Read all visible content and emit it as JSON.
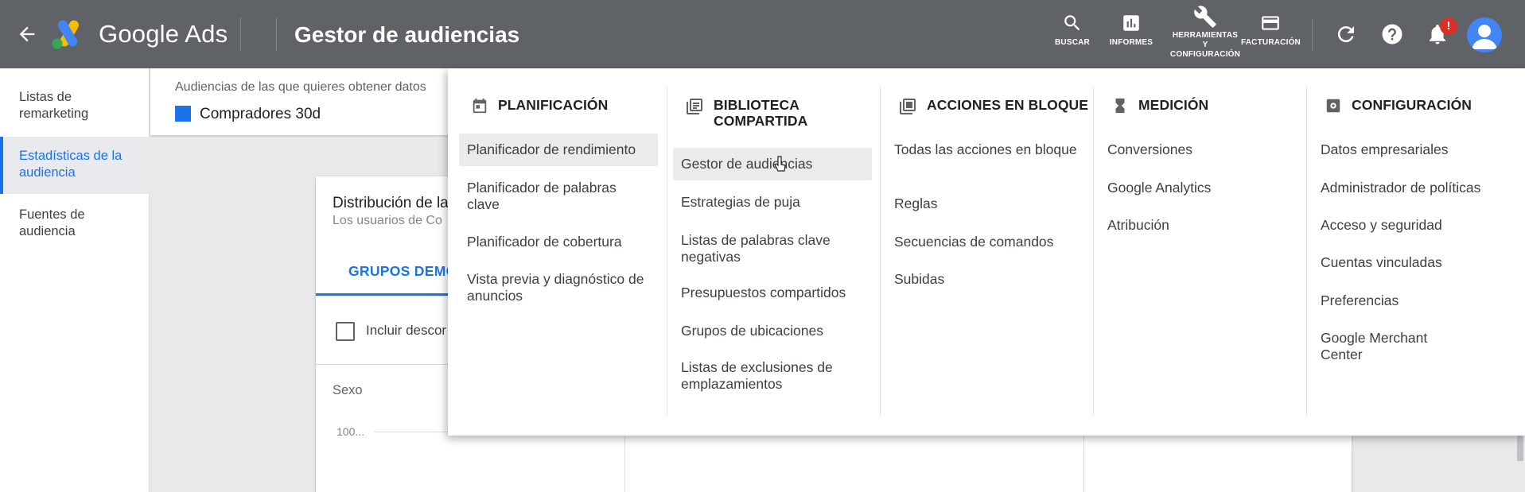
{
  "header": {
    "brand": "Google Ads",
    "page_title": "Gestor de audiencias",
    "tools": [
      {
        "label": "BUSCAR",
        "icon": "search-icon"
      },
      {
        "label": "INFORMES",
        "icon": "reports-icon"
      },
      {
        "label": "HERRAMIENTAS\nY\nCONFIGURACIÓN",
        "icon": "wrench-icon"
      },
      {
        "label": "FACTURACIÓN",
        "icon": "credit-card-icon"
      }
    ],
    "notification_badge": "!",
    "colors": {
      "header_bg": "#5f6368",
      "accent": "#1a73e8",
      "badge": "#d93025"
    }
  },
  "sidebar": {
    "items": [
      {
        "label": "Listas de remarketing"
      },
      {
        "label": "Estadísticas de la audiencia"
      },
      {
        "label": "Fuentes de audiencia"
      }
    ]
  },
  "main": {
    "segment_label": "Audiencias de las que quieres obtener datos",
    "segment_name": "Compradores 30d",
    "card_title": "Distribución de la",
    "card_subtitle": "Los usuarios de Co",
    "tab_label": "GRUPOS DEMO",
    "checkbox_label": "Incluir descor",
    "section_label": "Sexo",
    "axis_label": "100..."
  },
  "menu": {
    "columns": [
      {
        "heading": "PLANIFICACIÓN",
        "icon": "calendar-icon",
        "items": [
          {
            "label": "Planificador de rendimiento"
          },
          {
            "label": "Planificador de palabras clave"
          },
          {
            "label": "Planificador de cobertura"
          },
          {
            "label": "Vista previa y diagnóstico de anuncios"
          }
        ]
      },
      {
        "heading": "BIBLIOTECA COMPARTIDA",
        "icon": "library-icon",
        "items": [
          {
            "label": "Gestor de audiencias"
          },
          {
            "label": "Estrategias de puja"
          },
          {
            "label": "Listas de palabras clave negativas"
          },
          {
            "label": "Presupuestos compartidos"
          },
          {
            "label": "Grupos de ubicaciones"
          },
          {
            "label": "Listas de exclusiones de emplazamientos"
          }
        ]
      },
      {
        "heading": "ACCIONES EN BLOQUE",
        "icon": "bulk-actions-icon",
        "items": [
          {
            "label": "Todas las acciones en bloque"
          },
          {
            "label": "Reglas"
          },
          {
            "label": "Secuencias de comandos"
          },
          {
            "label": "Subidas"
          }
        ]
      },
      {
        "heading": "MEDICIÓN",
        "icon": "hourglass-icon",
        "items": [
          {
            "label": "Conversiones"
          },
          {
            "label": "Google Analytics"
          },
          {
            "label": "Atribución"
          }
        ]
      },
      {
        "heading": "CONFIGURACIÓN",
        "icon": "settings-icon",
        "items": [
          {
            "label": "Datos empresariales"
          },
          {
            "label": "Administrador de políticas"
          },
          {
            "label": "Acceso y seguridad"
          },
          {
            "label": "Cuentas vinculadas"
          },
          {
            "label": "Preferencias"
          },
          {
            "label": "Google Merchant Center"
          }
        ]
      }
    ]
  }
}
